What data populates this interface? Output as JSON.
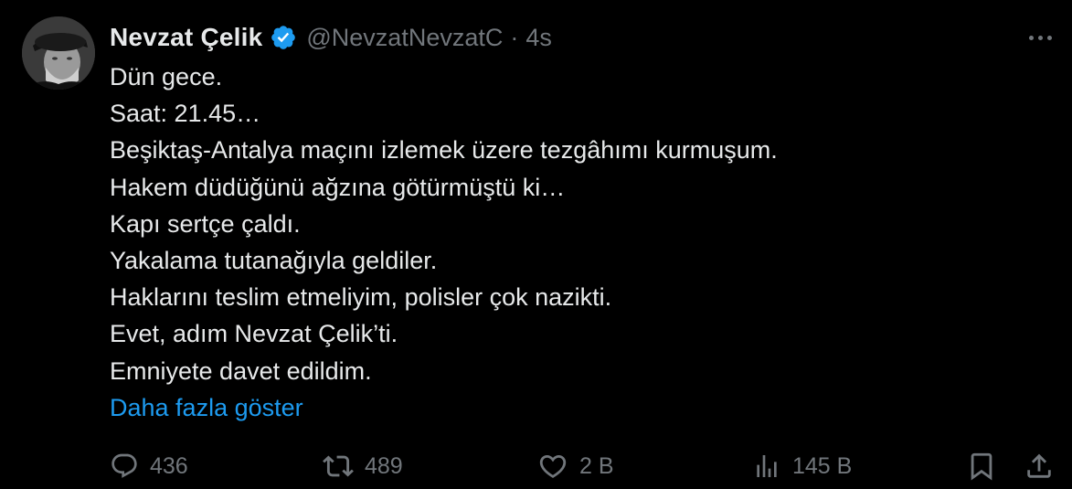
{
  "author": {
    "display_name": "Nevzat Çelik",
    "handle": "@NevzatNevzatC",
    "separator": "·",
    "time": "4s"
  },
  "tweet": {
    "lines": [
      "Dün gece.",
      "Saat: 21.45…",
      "Beşiktaş-Antalya maçını izlemek üzere tezgâhımı kurmuşum.",
      "Hakem düdüğünü ağzına götürmüştü ki…",
      "Kapı sertçe çaldı.",
      "Yakalama tutanağıyla geldiler.",
      "Haklarını teslim etmeliyim, polisler çok nazikti.",
      "Evet, adım Nevzat Çelik’ti.",
      "Emniyete davet edildim."
    ],
    "show_more": "Daha fazla göster"
  },
  "actions": {
    "reply_count": "436",
    "repost_count": "489",
    "like_count": "2 B",
    "views_count": "145 B"
  },
  "icons": {
    "verified": "verified-badge-icon",
    "more": "more-options-icon",
    "reply": "reply-icon",
    "repost": "repost-icon",
    "like": "heart-icon",
    "views": "views-chart-icon",
    "bookmark": "bookmark-icon",
    "share": "share-icon"
  },
  "colors": {
    "background": "#000000",
    "text": "#e7e9ea",
    "secondary": "#71767b",
    "link": "#1d9bf0",
    "verified": "#1d9bf0"
  }
}
